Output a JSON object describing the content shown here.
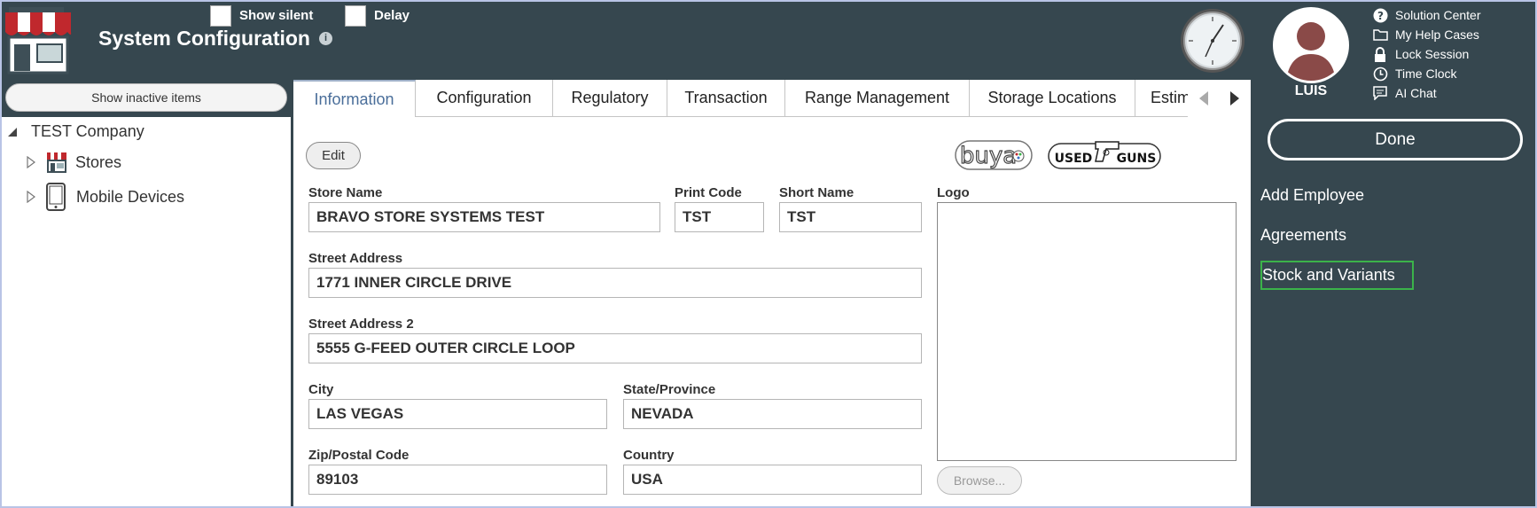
{
  "header": {
    "title": "System Configuration",
    "info_glyph": "i",
    "show_silent_label": "Show silent",
    "delay_label": "Delay"
  },
  "user": {
    "name": "LUIS"
  },
  "help_links": [
    {
      "icon": "question-circle-icon",
      "label": "Solution Center"
    },
    {
      "icon": "folder-icon",
      "label": "My Help Cases"
    },
    {
      "icon": "lock-icon",
      "label": "Lock Session"
    },
    {
      "icon": "clock-icon",
      "label": "Time Clock"
    },
    {
      "icon": "chat-icon",
      "label": "AI Chat"
    }
  ],
  "sidebar": {
    "done_label": "Done",
    "links": [
      {
        "label": "Add Employee",
        "selected": false
      },
      {
        "label": "Agreements",
        "selected": false
      },
      {
        "label": "Stock and Variants",
        "selected": true
      }
    ],
    "selected_color": "#3bb34a"
  },
  "tree": {
    "inactive_button": "Show inactive items",
    "root": "TEST Company",
    "children": [
      {
        "label": "Stores",
        "icon": "store-icon"
      },
      {
        "label": "Mobile Devices",
        "icon": "mobile-device-icon"
      }
    ]
  },
  "tabs": [
    {
      "label": "Information",
      "active": true
    },
    {
      "label": "Configuration",
      "active": false
    },
    {
      "label": "Regulatory",
      "active": false
    },
    {
      "label": "Transaction",
      "active": false
    },
    {
      "label": "Range Management",
      "active": false
    },
    {
      "label": "Storage Locations",
      "active": false
    },
    {
      "label": "Estim",
      "active": false
    }
  ],
  "form": {
    "edit_label": "Edit",
    "store_name": {
      "label": "Store Name",
      "value": "BRAVO STORE SYSTEMS TEST"
    },
    "print_code": {
      "label": "Print Code",
      "value": "TST"
    },
    "short_name": {
      "label": "Short Name",
      "value": "TST"
    },
    "street_address": {
      "label": "Street Address",
      "value": "1771 INNER CIRCLE DRIVE"
    },
    "street_address_2": {
      "label": "Street Address 2",
      "value": "5555 G-FEED OUTER CIRCLE LOOP"
    },
    "city": {
      "label": "City",
      "value": "LAS VEGAS"
    },
    "state": {
      "label": "State/Province",
      "value": "NEVADA"
    },
    "zip": {
      "label": "Zip/Postal Code",
      "value": "89103"
    },
    "country": {
      "label": "Country",
      "value": "USA"
    },
    "logo_label": "Logo",
    "browse_label": "Browse...",
    "brand_logos": {
      "buya": "buya",
      "used": "USED",
      "guns": "GUNS"
    }
  },
  "colors": {
    "background": "#36474f",
    "active_tab_text": "#4a6e9a"
  }
}
